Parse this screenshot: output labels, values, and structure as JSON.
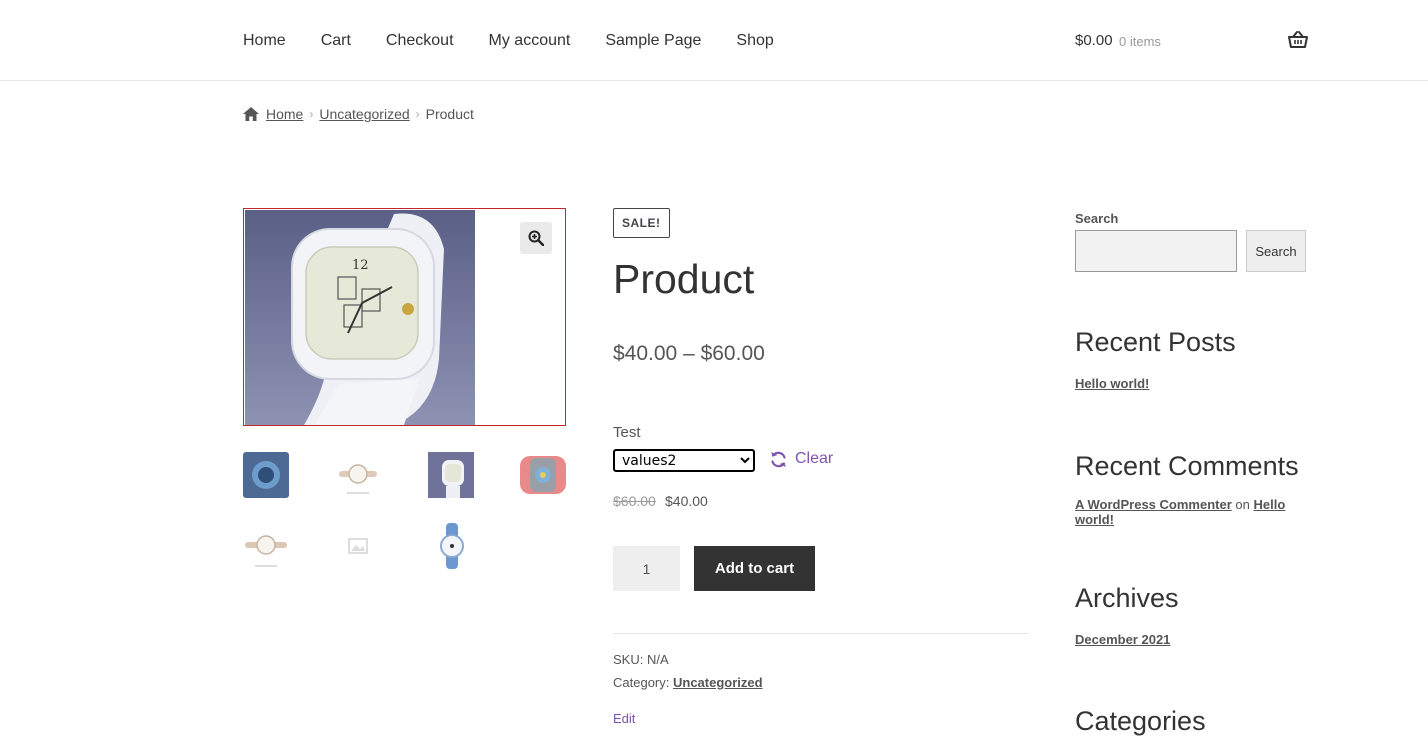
{
  "nav": {
    "items": [
      "Home",
      "Cart",
      "Checkout",
      "My account",
      "Sample Page",
      "Shop"
    ]
  },
  "header_cart": {
    "total": "$0.00",
    "count": "0 items",
    "icon": "basket-icon"
  },
  "breadcrumb": {
    "items": [
      "Home",
      "Uncategorized",
      "Product"
    ],
    "separator": "›"
  },
  "product": {
    "badge": "SALE!",
    "title": "Product",
    "price_range": "$40.00 – $60.00",
    "variation_label": "Test",
    "variation_selected": "values2",
    "clear_label": "Clear",
    "old_price": "$60.00",
    "new_price": "$40.00",
    "quantity": "1",
    "add_to_cart_label": "Add to cart",
    "sku_label": "SKU:",
    "sku_value": "N/A",
    "category_label": "Category:",
    "category_value": "Uncategorized",
    "edit_label": "Edit"
  },
  "sidebar": {
    "search_label": "Search",
    "search_button": "Search",
    "recent_posts_heading": "Recent Posts",
    "recent_posts": [
      "Hello world!"
    ],
    "recent_comments_heading": "Recent Comments",
    "comment_author": "A WordPress Commenter",
    "comment_on": "on",
    "comment_post": "Hello world!",
    "archives_heading": "Archives",
    "archives": [
      "December 2021"
    ],
    "categories_heading": "Categories"
  },
  "colors": {
    "accent": "#7f54b3",
    "button_dark": "#333333",
    "image_border": "#c1272d"
  }
}
